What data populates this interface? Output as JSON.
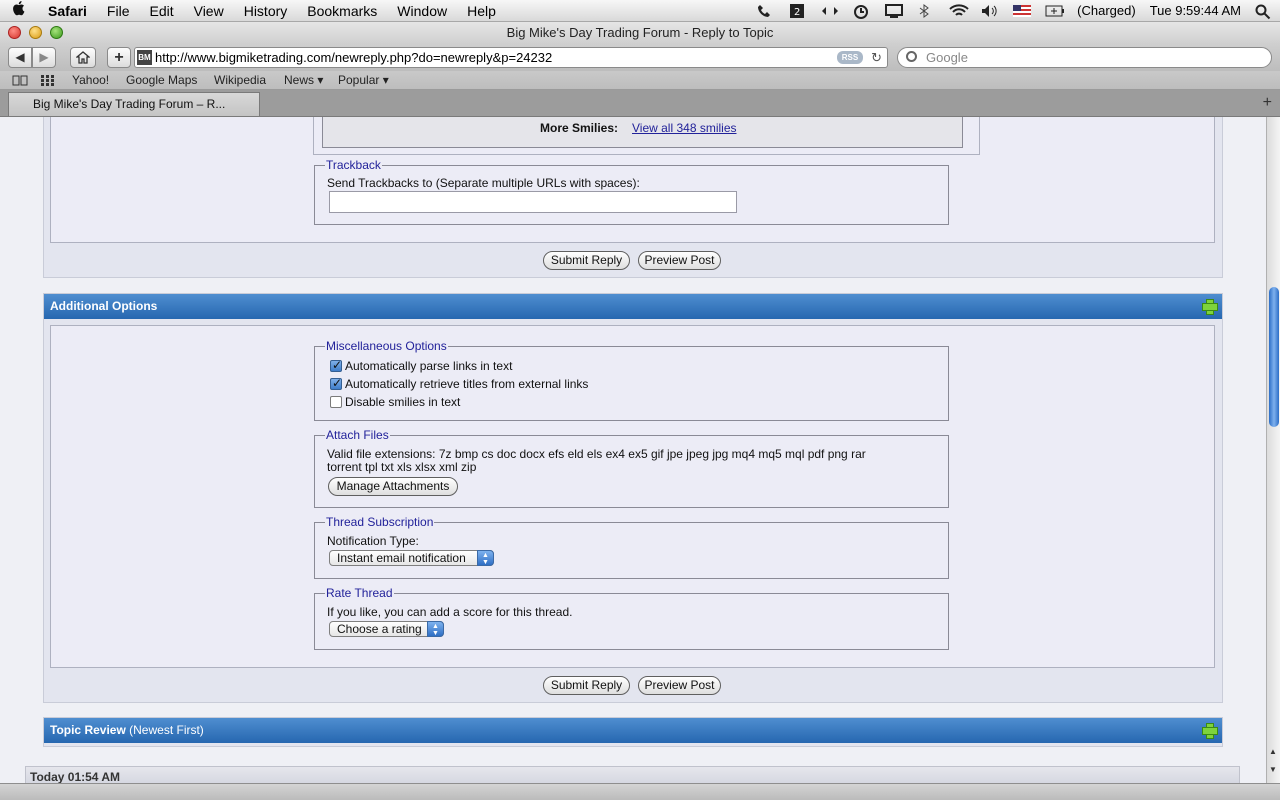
{
  "menubar": {
    "app": "Safari",
    "items": [
      "File",
      "Edit",
      "View",
      "History",
      "Bookmarks",
      "Window",
      "Help"
    ],
    "battery": "(Charged)",
    "clock": "Tue 9:59:44 AM"
  },
  "window": {
    "title": "Big Mike's Day Trading Forum - Reply to Topic"
  },
  "toolbar": {
    "url": "http://www.bigmiketrading.com/newreply.php?do=newreply&p=24232",
    "favicon": "BM",
    "rss": "RSS",
    "search_placeholder": "Google"
  },
  "bookmarks": {
    "items": [
      "Yahoo!",
      "Google Maps",
      "Wikipedia",
      "News ▾",
      "Popular ▾"
    ]
  },
  "tab": {
    "label": "Big Mike's Day Trading Forum – R..."
  },
  "page": {
    "more_smilies_label": "More Smilies:",
    "more_smilies_link": "View all 348 smilies",
    "trackback": {
      "legend": "Trackback",
      "label": "Send Trackbacks to (Separate multiple URLs with spaces):",
      "value": ""
    },
    "buttons": {
      "submit": "Submit Reply",
      "preview": "Preview Post"
    },
    "additional_options": {
      "title": "Additional Options",
      "misc": {
        "legend": "Miscellaneous Options",
        "options": [
          {
            "label": "Automatically parse links in text",
            "checked": true
          },
          {
            "label": "Automatically retrieve titles from external links",
            "checked": true
          },
          {
            "label": "Disable smilies in text",
            "checked": false
          }
        ]
      },
      "attach": {
        "legend": "Attach Files",
        "line1": "Valid file extensions: 7z bmp cs doc docx efs eld els ex4 ex5 gif jpe jpeg jpg mq4 mq5 mql pdf png rar",
        "line2": "torrent tpl txt xls xlsx xml zip",
        "button": "Manage Attachments"
      },
      "subscription": {
        "legend": "Thread Subscription",
        "label": "Notification Type:",
        "selected": "Instant email notification"
      },
      "rate": {
        "legend": "Rate Thread",
        "label": "If you like, you can add a score for this thread.",
        "selected": "Choose a rating"
      }
    },
    "topic_review": {
      "title": "Topic Review",
      "subtitle": "(Newest First)"
    },
    "post_time": "Today 01:54 AM"
  }
}
